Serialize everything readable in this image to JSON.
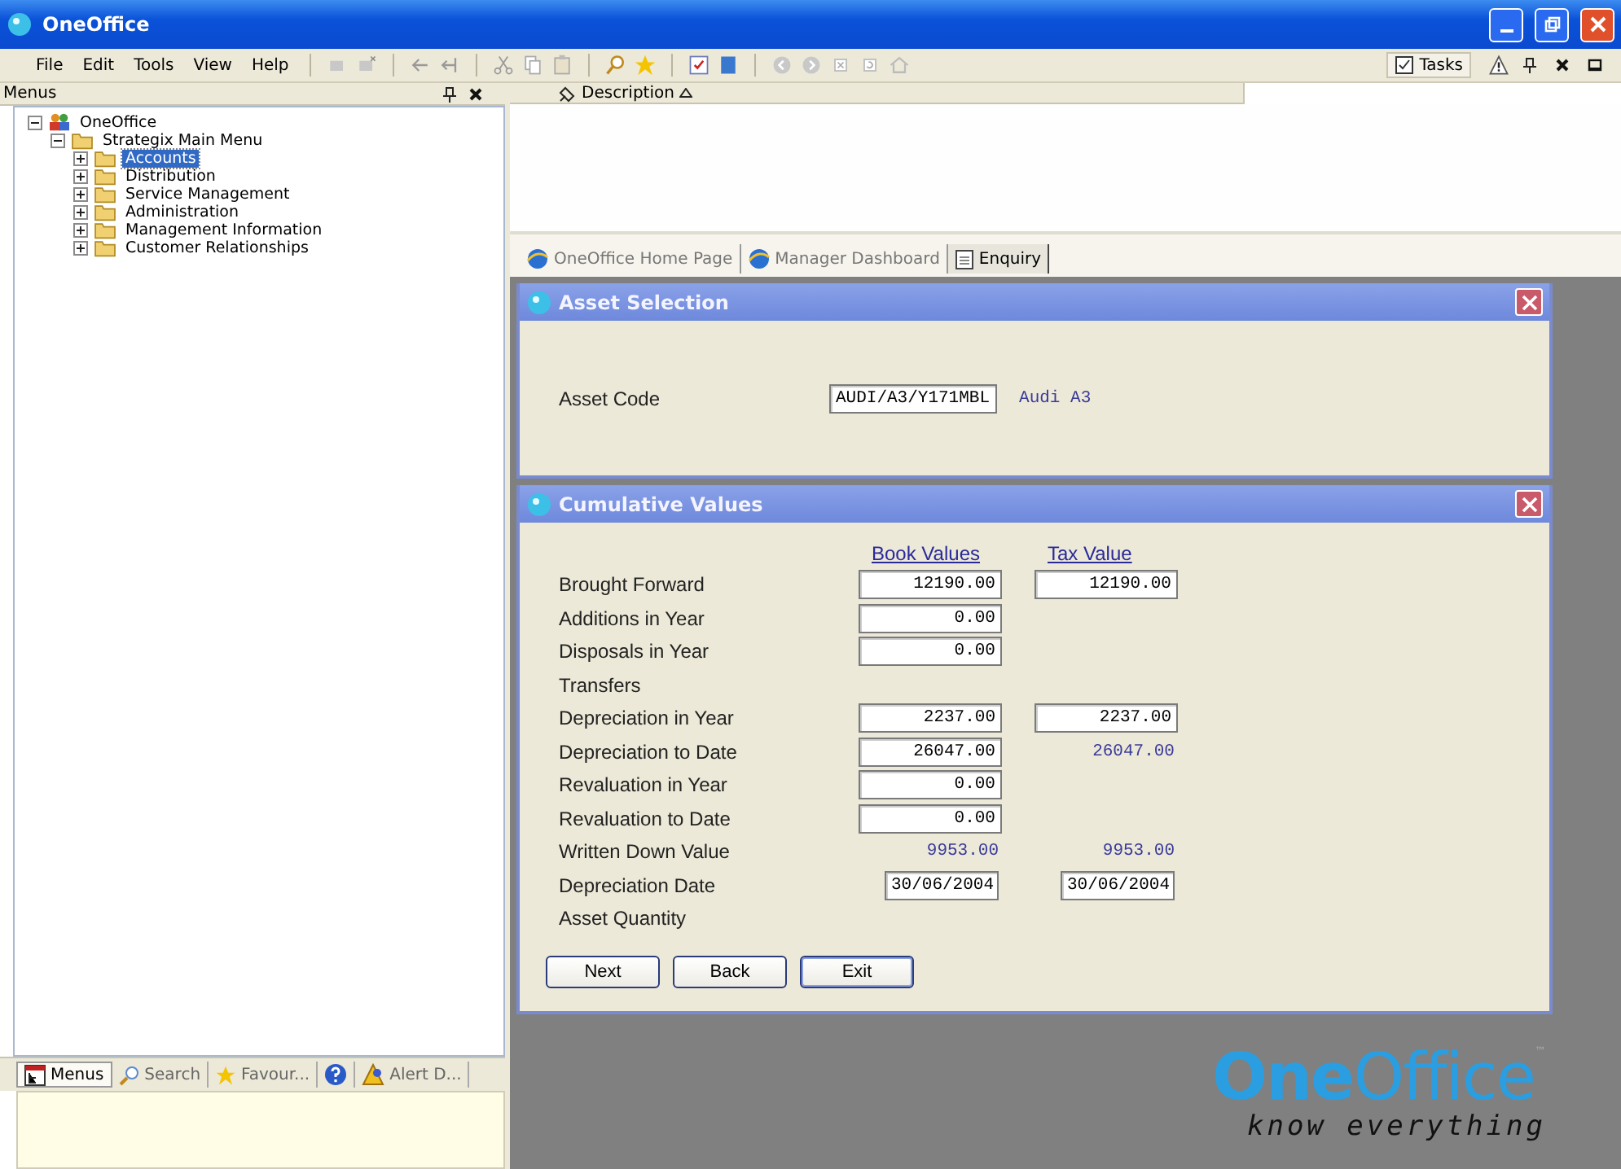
{
  "window": {
    "title": "OneOffice"
  },
  "menu": [
    "File",
    "Edit",
    "Tools",
    "View",
    "Help"
  ],
  "tasks_button": "Tasks",
  "menus_panel": {
    "title": "Menus",
    "tree": [
      {
        "label": "OneOffice",
        "expanded": true,
        "selected": false,
        "children": [
          {
            "label": "Strategix Main Menu",
            "expanded": true,
            "selected": false,
            "children": [
              {
                "label": "Accounts",
                "expanded": false,
                "selected": true
              },
              {
                "label": "Distribution",
                "expanded": false,
                "selected": false
              },
              {
                "label": "Service Management",
                "expanded": false,
                "selected": false
              },
              {
                "label": "Administration",
                "expanded": false,
                "selected": false
              },
              {
                "label": "Management Information",
                "expanded": false,
                "selected": false
              },
              {
                "label": "Customer Relationships",
                "expanded": false,
                "selected": false
              }
            ]
          }
        ]
      }
    ],
    "bottom_tabs": [
      {
        "label": "Menus",
        "kind": "menus",
        "selected": true
      },
      {
        "label": "Search",
        "kind": "search",
        "selected": false
      },
      {
        "label": "Favour...",
        "kind": "favourites",
        "selected": false
      },
      {
        "kind": "help",
        "selected": false
      },
      {
        "label": "Alert D...",
        "kind": "alerts",
        "selected": false
      }
    ]
  },
  "list_header": {
    "column_1": "Description"
  },
  "tabs": [
    {
      "label": "OneOffice Home Page",
      "kind": "web",
      "selected": false
    },
    {
      "label": "Manager Dashboard",
      "kind": "web",
      "selected": false
    },
    {
      "label": "Enquiry",
      "kind": "form",
      "selected": true
    }
  ],
  "asset_selection": {
    "title": "Asset Selection",
    "label": "Asset Code",
    "value": "AUDI/A3/Y171MBL",
    "description": "Audi A3"
  },
  "cumulative_values": {
    "title": "Cumulative Values",
    "columns": [
      "Book Values",
      "Tax Value"
    ],
    "rows": [
      {
        "label": "Brought Forward",
        "book": {
          "value": "12190.00",
          "kind": "field"
        },
        "tax": {
          "value": "12190.00",
          "kind": "field"
        }
      },
      {
        "label": "Additions in Year",
        "book": {
          "value": "0.00",
          "kind": "field"
        }
      },
      {
        "label": "Disposals in Year",
        "book": {
          "value": "0.00",
          "kind": "field"
        }
      },
      {
        "label": "Transfers"
      },
      {
        "label": "Depreciation in Year",
        "book": {
          "value": "2237.00",
          "kind": "field"
        },
        "tax": {
          "value": "2237.00",
          "kind": "field"
        }
      },
      {
        "label": "Depreciation to Date",
        "book": {
          "value": "26047.00",
          "kind": "field"
        },
        "tax": {
          "value": "26047.00",
          "kind": "text"
        }
      },
      {
        "label": "Revaluation in Year",
        "book": {
          "value": "0.00",
          "kind": "field"
        }
      },
      {
        "label": "Revaluation to Date",
        "book": {
          "value": "0.00",
          "kind": "field"
        }
      },
      {
        "label": "Written Down Value",
        "book": {
          "value": "9953.00",
          "kind": "text"
        },
        "tax": {
          "value": "9953.00",
          "kind": "text"
        }
      },
      {
        "label": "Depreciation Date",
        "book": {
          "value": "30/06/2004",
          "kind": "date"
        },
        "tax": {
          "value": "30/06/2004",
          "kind": "date"
        }
      },
      {
        "label": "Asset Quantity"
      }
    ],
    "buttons": [
      "Next",
      "Back",
      "Exit"
    ]
  },
  "logo": {
    "name": "**One**Office",
    "mark": "™",
    "tagline": "know everything"
  }
}
